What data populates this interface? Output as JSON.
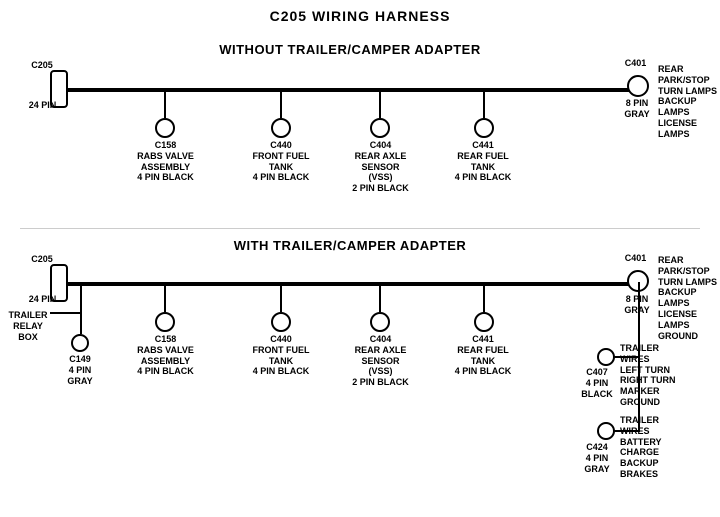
{
  "title": "C205 WIRING HARNESS",
  "section1": {
    "label": "WITHOUT  TRAILER/CAMPER  ADAPTER",
    "connectors": [
      {
        "id": "C205_top",
        "label": "C205\n24 PIN"
      },
      {
        "id": "C401_top",
        "label": "C401\n8 PIN\nGRAY"
      },
      {
        "id": "C158_top",
        "label": "C158\nRABS VALVE\nASSEMBLY\n4 PIN BLACK"
      },
      {
        "id": "C440_top",
        "label": "C440\nFRONT FUEL\nTANK\n4 PIN BLACK"
      },
      {
        "id": "C404_top",
        "label": "C404\nREAR AXLE\nSENSOR\n(VSS)\n2 PIN BLACK"
      },
      {
        "id": "C441_top",
        "label": "C441\nREAR FUEL\nTANK\n4 PIN BLACK"
      }
    ],
    "right_label": "REAR PARK/STOP\nTURN LAMPS\nBACKUP LAMPS\nLICENSE LAMPS"
  },
  "section2": {
    "label": "WITH  TRAILER/CAMPER  ADAPTER",
    "connectors": [
      {
        "id": "C205_bot",
        "label": "C205\n24 PIN"
      },
      {
        "id": "C401_bot",
        "label": "C401\n8 PIN\nGRAY"
      },
      {
        "id": "C158_bot",
        "label": "C158\nRABS VALVE\nASSEMBLY\n4 PIN BLACK"
      },
      {
        "id": "C440_bot",
        "label": "C440\nFRONT FUEL\nTANK\n4 PIN BLACK"
      },
      {
        "id": "C404_bot",
        "label": "C404\nREAR AXLE\nSENSOR\n(VSS)\n2 PIN BLACK"
      },
      {
        "id": "C441_bot",
        "label": "C441\nREAR FUEL\nTANK\n4 PIN BLACK"
      },
      {
        "id": "C149",
        "label": "C149\n4 PIN GRAY"
      },
      {
        "id": "C407",
        "label": "C407\n4 PIN\nBLACK"
      },
      {
        "id": "C424",
        "label": "C424\n4 PIN\nGRAY"
      }
    ],
    "right_labels": [
      "REAR PARK/STOP\nTURN LAMPS\nBACKUP LAMPS\nLICENSE LAMPS\nGROUND",
      "TRAILER WIRES\nLEFT TURN\nRIGHT TURN\nMARKER\nGROUND",
      "TRAILER WIRES\nBATTERY CHARGE\nBACKUP\nBRAKES"
    ],
    "trailer_relay": "TRAILER\nRELAY\nBOX"
  }
}
